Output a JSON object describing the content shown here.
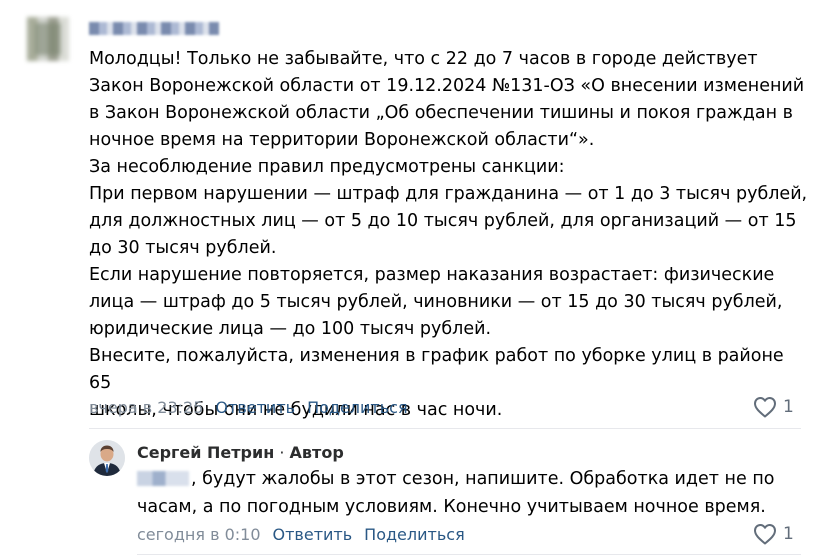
{
  "comment": {
    "text": "Молодцы! Только не забывайте, что с 22 до 7 часов в городе действует\nЗакон Воронежской области от 19.12.2024 №131-ОЗ «О внесении изменений\nв Закон Воронежской области „Об обеспечении тишины и покоя граждан в\nночное время на территории Воронежской области“».\nЗа несоблюдение правил предусмотрены санкции:\nПри первом нарушении — штраф для гражданина — от 1 до 3 тысяч рублей,\nдля должностных лиц — от 5 до 10 тысяч рублей, для организаций — от 15\nдо 30 тысяч рублей.\nЕсли нарушение повторяется, размер наказания возрастает: физические\nлица — штраф до 5 тысяч рублей, чиновники — от 15 до 30 тысяч рублей,\nюридические лица — до 100 тысяч рублей.\nВнесите, пожалуйста, изменения в график работ по уборке улиц в районе 65\nшколы, чтобы они не будили нас в час ночи.",
    "time": "вчера в 23:25",
    "reply_label": "Ответить",
    "share_label": "Поделиться",
    "likes": "1"
  },
  "reply": {
    "author": "Сергей Петрин",
    "separator": " · ",
    "role": "Автор",
    "text": ", будут жалобы в этот сезон, напишите. Обработка идет не по\nчасам, а по погодным условиям. Конечно учитываем ночное время.",
    "time": "сегодня в 0:10",
    "reply_label": "Ответить",
    "share_label": "Поделиться",
    "likes": "1"
  },
  "icons": {
    "like": "heart-outline-icon"
  },
  "colors": {
    "link": "#2a5885",
    "meta": "#818c99",
    "like_icon": "#626d7a"
  }
}
